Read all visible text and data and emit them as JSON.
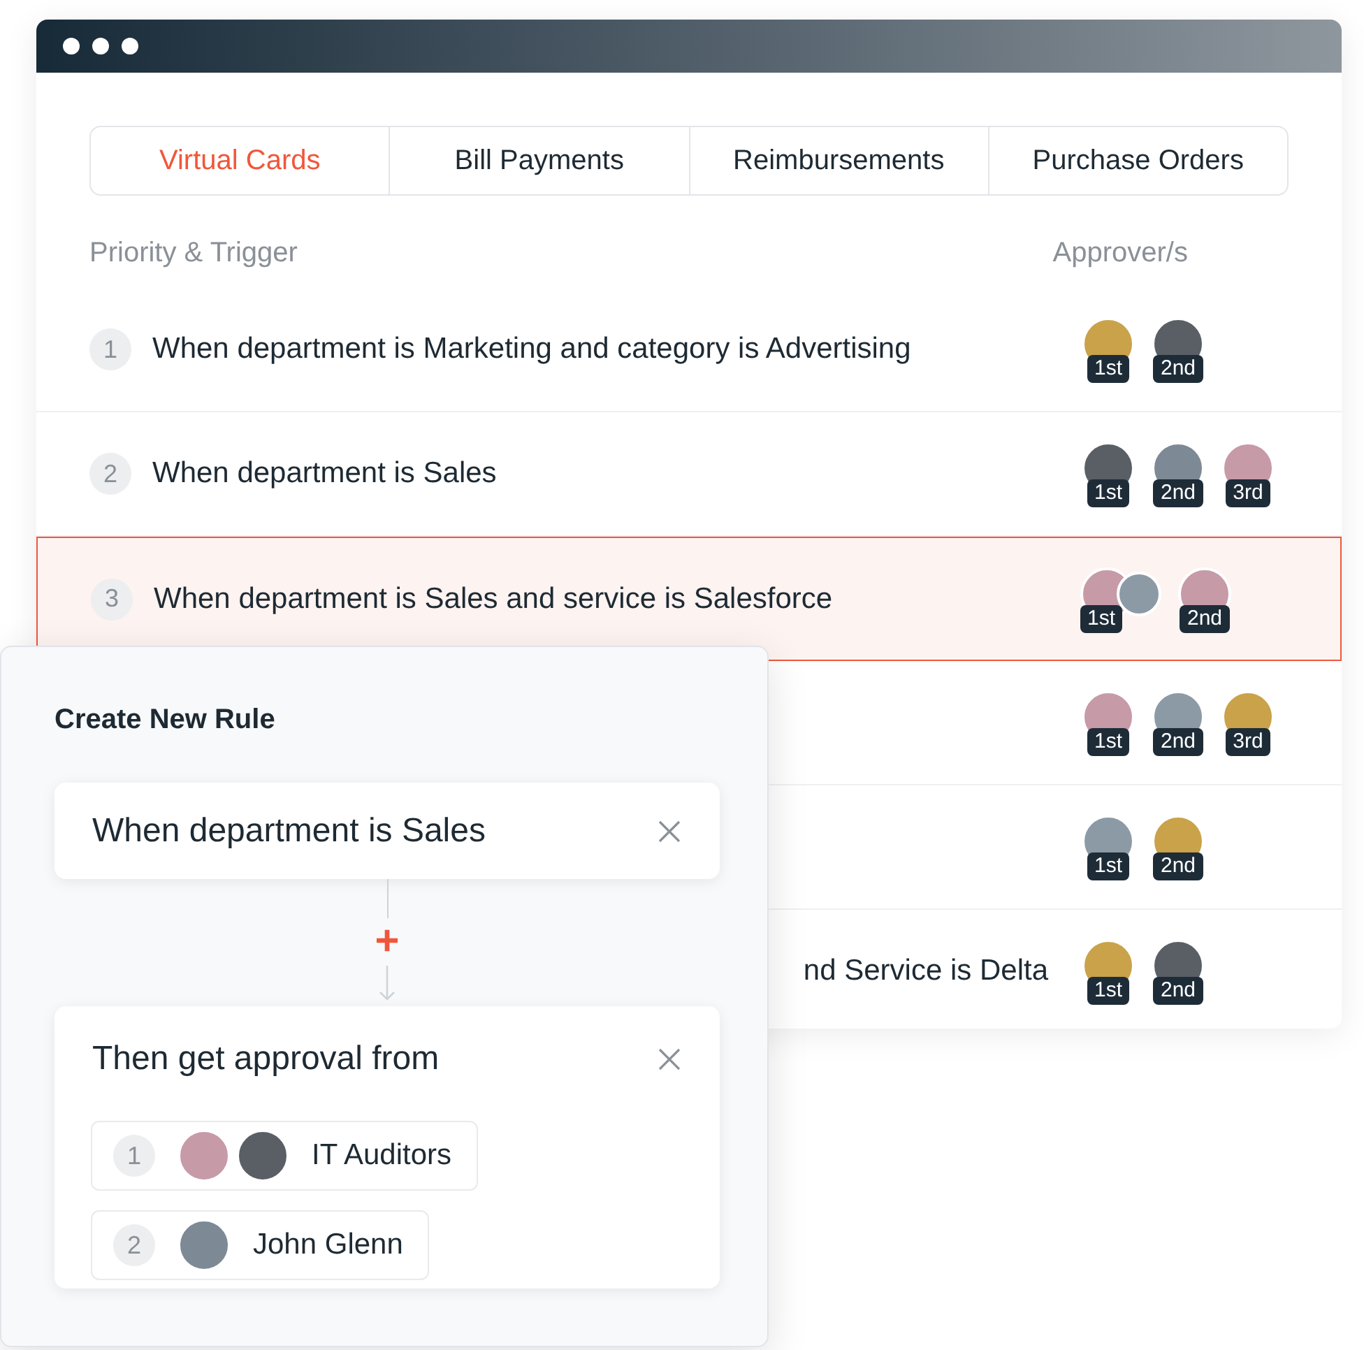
{
  "tabs": [
    {
      "label": "Virtual Cards",
      "selected": true
    },
    {
      "label": "Bill Payments",
      "selected": false
    },
    {
      "label": "Reimbursements",
      "selected": false
    },
    {
      "label": "Purchase Orders",
      "selected": false
    }
  ],
  "table": {
    "columns": [
      "Priority & Trigger",
      "Approver/s"
    ],
    "rows": [
      {
        "kind": "full",
        "number": "1",
        "trigger": "When department is Marketing and category is Advertising",
        "selected": false,
        "approvers": [
          {
            "kind": "single",
            "badge": "1st"
          },
          {
            "kind": "single",
            "badge": "2nd"
          }
        ]
      },
      {
        "kind": "full",
        "number": "2",
        "trigger": "When department is Sales",
        "selected": false,
        "approvers": [
          {
            "kind": "single",
            "badge": "1st"
          },
          {
            "kind": "single",
            "badge": "2nd"
          },
          {
            "kind": "single",
            "badge": "3rd"
          }
        ]
      },
      {
        "kind": "full",
        "number": "3",
        "trigger": "When department is Sales and service is Salesforce",
        "selected": true,
        "approvers": [
          {
            "kind": "group",
            "badge": "1st"
          },
          {
            "kind": "single",
            "badge": "2nd"
          }
        ]
      },
      {
        "kind": "covered",
        "selected": false,
        "approvers": [
          {
            "kind": "single",
            "badge": "1st"
          },
          {
            "kind": "single",
            "badge": "2nd"
          },
          {
            "kind": "single",
            "badge": "3rd"
          }
        ]
      },
      {
        "kind": "covered",
        "selected": false,
        "approvers": [
          {
            "kind": "single",
            "badge": "1st"
          },
          {
            "kind": "single",
            "badge": "2nd"
          }
        ]
      },
      {
        "kind": "covered",
        "trigger": "nd Service is Delta",
        "selected": false,
        "approvers": [
          {
            "kind": "single",
            "badge": "1st"
          },
          {
            "kind": "single",
            "badge": "2nd"
          }
        ]
      }
    ]
  },
  "rule_panel": {
    "title": "Create New Rule",
    "condition": "When department is Sales",
    "add_symbol": "+",
    "action": "Then get approval from",
    "approvers": [
      {
        "kind": "group",
        "number": "1",
        "name": "IT Auditors"
      },
      {
        "kind": "single",
        "number": "2",
        "name": "John Glenn"
      }
    ]
  }
}
